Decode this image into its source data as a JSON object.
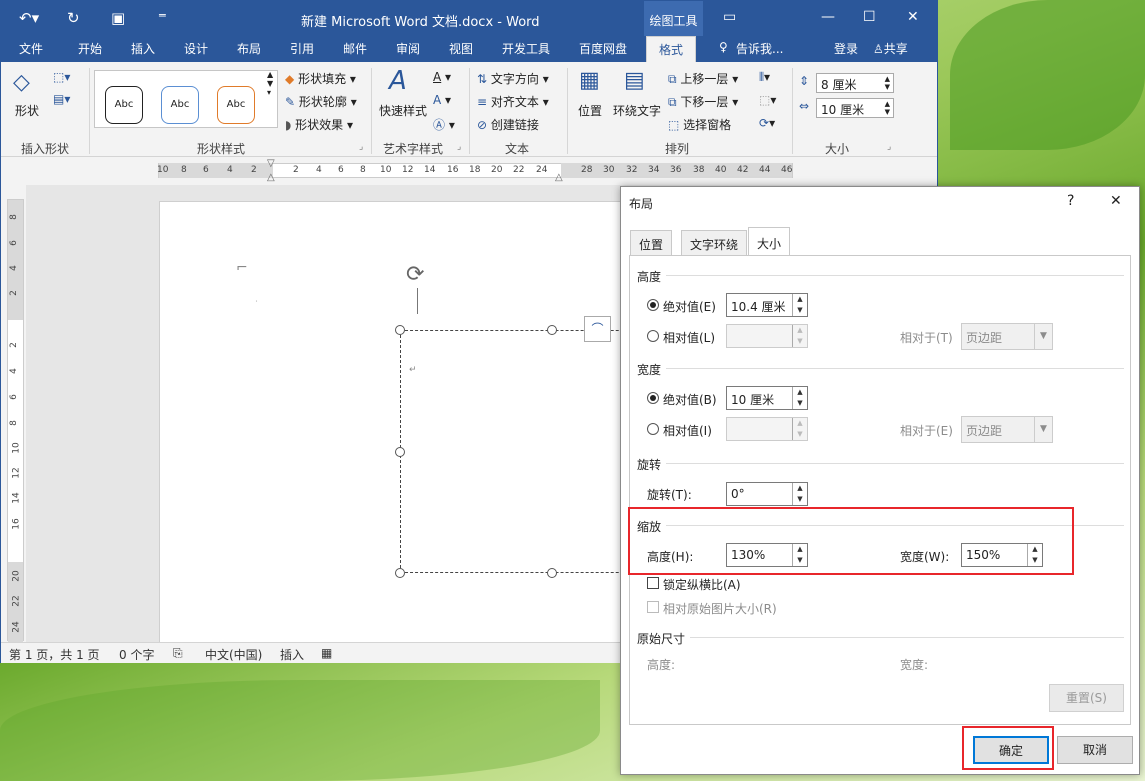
{
  "window": {
    "title": "新建 Microsoft Word 文档.docx - Word",
    "context_tab_group": "绘图工具"
  },
  "tabs": [
    "文件",
    "开始",
    "插入",
    "设计",
    "布局",
    "引用",
    "邮件",
    "审阅",
    "视图",
    "开发工具",
    "百度网盘",
    "格式"
  ],
  "tell_me": "告诉我...",
  "account": {
    "login": "登录",
    "share": "共享"
  },
  "ribbon": {
    "insert_shapes": {
      "shape_btn": "形状",
      "label": "插入形状"
    },
    "shape_styles": {
      "samples": [
        "Abc",
        "Abc",
        "Abc"
      ],
      "fill": "形状填充",
      "outline": "形状轮廓",
      "effects": "形状效果",
      "label": "形状样式"
    },
    "wordart": {
      "quick_styles": "快速样式",
      "label": "艺术字样式"
    },
    "text": {
      "direction": "文字方向",
      "align": "对齐文本",
      "link": "创建链接",
      "label": "文本"
    },
    "arrange": {
      "position": "位置",
      "wrap": "环绕文字",
      "forward": "上移一层",
      "backward": "下移一层",
      "pane": "选择窗格",
      "label": "排列"
    },
    "size": {
      "height": "8 厘米",
      "width": "10 厘米",
      "label": "大小"
    }
  },
  "ruler_h": [
    "10",
    "8",
    "6",
    "4",
    "2",
    "2",
    "4",
    "6",
    "8",
    "10",
    "12",
    "14",
    "16",
    "18",
    "20",
    "22",
    "24",
    "28",
    "30",
    "32",
    "34",
    "36",
    "38",
    "40",
    "42",
    "44",
    "46"
  ],
  "ruler_v": [
    "8",
    "6",
    "4",
    "2",
    "2",
    "4",
    "6",
    "8",
    "10",
    "12",
    "14",
    "16",
    "20",
    "22",
    "24"
  ],
  "status": {
    "page": "第 1 页，共 1 页",
    "words": "0 个字",
    "lang": "中文(中国)",
    "mode": "插入"
  },
  "dialog": {
    "title": "布局",
    "help": "?",
    "close": "✕",
    "tabs": [
      "位置",
      "文字环绕",
      "大小"
    ],
    "height_section": "高度",
    "width_section": "宽度",
    "rotate_section": "旋转",
    "scale_section": "缩放",
    "original_section": "原始尺寸",
    "absolute_label_h": "绝对值(E)",
    "absolute_value_h": "10.4 厘米",
    "relative_label_h": "相对值(L)",
    "relative_to_h": "相对于(T)",
    "relative_select_h": "页边距",
    "absolute_label_w": "绝对值(B)",
    "absolute_value_w": "10 厘米",
    "relative_label_w": "相对值(I)",
    "relative_to_w": "相对于(E)",
    "relative_select_w": "页边距",
    "rotation_label": "旋转(T):",
    "rotation_value": "0°",
    "scale_height_label": "高度(H):",
    "scale_height_value": "130%",
    "scale_width_label": "宽度(W):",
    "scale_width_value": "150%",
    "lock_ratio": "锁定纵横比(A)",
    "relative_original": "相对原始图片大小(R)",
    "orig_height_label": "高度:",
    "orig_width_label": "宽度:",
    "reset": "重置(S)",
    "ok": "确定",
    "cancel": "取消"
  },
  "colors": {
    "accent": "#2b579a",
    "highlight": "#e8262b",
    "focus": "#0078d7"
  }
}
